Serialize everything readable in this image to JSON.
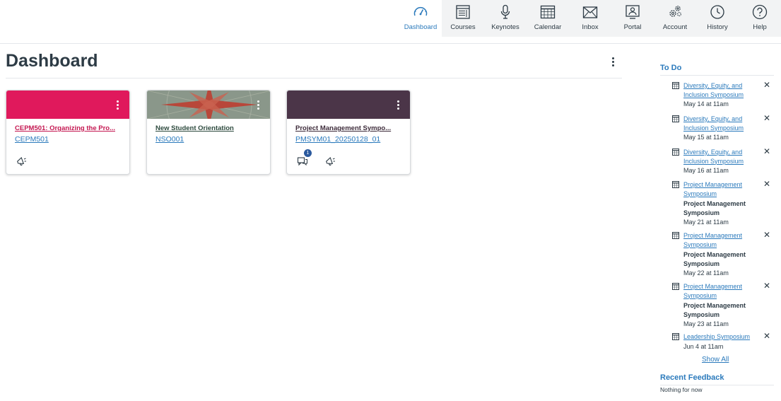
{
  "nav": {
    "items": [
      {
        "label": "Dashboard",
        "icon": "dashboard-icon",
        "active": true
      },
      {
        "label": "Courses",
        "icon": "courses-icon"
      },
      {
        "label": "Keynotes",
        "icon": "microphone-icon"
      },
      {
        "label": "Calendar",
        "icon": "calendar-icon"
      },
      {
        "label": "Inbox",
        "icon": "inbox-icon"
      },
      {
        "label": "Portal",
        "icon": "portal-icon"
      },
      {
        "label": "Account",
        "icon": "account-gear-icon"
      },
      {
        "label": "History",
        "icon": "history-clock-icon"
      },
      {
        "label": "Help",
        "icon": "help-icon"
      }
    ]
  },
  "page": {
    "title": "Dashboard"
  },
  "cards": [
    {
      "title": "CEPM501: Organizing the Pro...",
      "code": "CEPM501",
      "color": "#e0195c"
    },
    {
      "title": "New Student Orientation",
      "code": "NSO001",
      "color": "#8c9a8b"
    },
    {
      "title": "Project Management Sympo...",
      "code": "PMSYM01_20250128_01",
      "color": "#4b3548",
      "unread_badge": "1"
    }
  ],
  "colors": {
    "accent": "#2b7abc",
    "text": "#2d3b45",
    "card1_title": "#c41751"
  },
  "todo": {
    "heading": "To Do",
    "items": [
      {
        "link_line1": "Diversity, Equity, and",
        "link_line2": "Inclusion Symposium",
        "date": "May 14 at 11am"
      },
      {
        "link_line1": "Diversity, Equity, and",
        "link_line2": "Inclusion Symposium",
        "date": "May 15 at 11am"
      },
      {
        "link_line1": "Diversity, Equity, and",
        "link_line2": "Inclusion Symposium",
        "date": "May 16 at 11am"
      },
      {
        "link_line1": "Project Management",
        "link_line2": "Symposium",
        "sub_line1": "Project Management",
        "sub_line2": "Symposium",
        "date": "May 21 at 11am"
      },
      {
        "link_line1": "Project Management",
        "link_line2": "Symposium",
        "sub_line1": "Project Management",
        "sub_line2": "Symposium",
        "date": "May 22 at 11am"
      },
      {
        "link_line1": "Project Management",
        "link_line2": "Symposium",
        "sub_line1": "Project Management",
        "sub_line2": "Symposium",
        "date": "May 23 at 11am"
      },
      {
        "link_line1": "Leadership Symposium",
        "date": "Jun 4 at 11am"
      }
    ],
    "show_all": "Show All"
  },
  "recent_feedback": {
    "heading": "Recent Feedback",
    "empty": "Nothing for now"
  }
}
